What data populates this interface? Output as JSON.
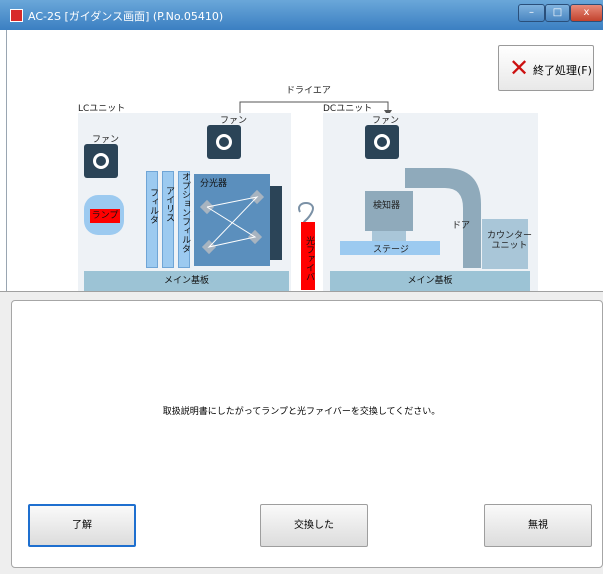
{
  "window": {
    "title": "AC-2S [ガイダンス画面] (P.No.05410)",
    "min_glyph": "–",
    "max_glyph": "□",
    "close_glyph": "x"
  },
  "toolbar": {
    "end_label": "終了処理(F)",
    "end_icon": "close-x-icon"
  },
  "diagram": {
    "dryer_label": "ドライエア",
    "lc_unit_label": "LCユニット",
    "dc_unit_label": "DCユニット",
    "lc_fan1_label": "ファン",
    "lc_fan2_label": "ファン",
    "dc_fan_label": "ファン",
    "lamp_label": "ランプ",
    "filter_label": "フィルタ",
    "iris_label": "アイリス",
    "option_filter_label": "オプションフィルタ",
    "monochromator_label": "分光器",
    "lc_mainboard_label": "メイン基板",
    "dc_mainboard_label": "メイン基板",
    "fiber_label": "光ファイバ",
    "detector_label": "検知器",
    "stage_label": "ステージ",
    "door_label": "ドア",
    "counter_unit_label": "カウンター\nユニット",
    "colors": {
      "panel": "#eef2f6",
      "bar": "#9ccaf0",
      "lamp": "#ff0000",
      "fan": "#2b4457"
    }
  },
  "dialog": {
    "message": "取扱説明書にしたがってランプと光ファイバーを交換してください。",
    "buttons": {
      "ok": "了解",
      "replaced": "交換した",
      "ignore": "無視"
    }
  }
}
